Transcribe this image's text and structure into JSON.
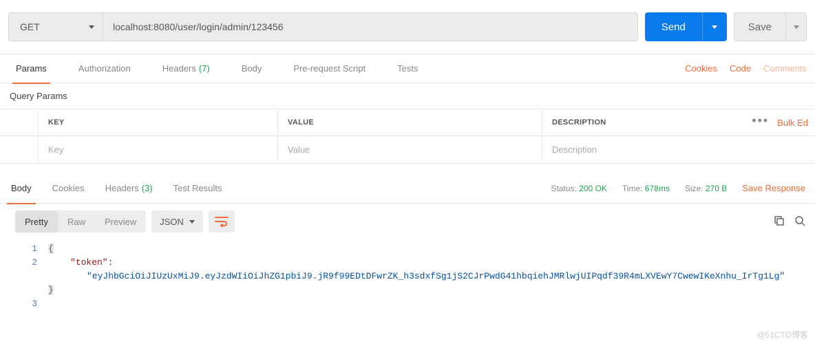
{
  "request": {
    "method": "GET",
    "url": "localhost:8080/user/login/admin/123456",
    "send_label": "Send",
    "save_label": "Save"
  },
  "req_tabs": {
    "params": "Params",
    "authorization": "Authorization",
    "headers": "Headers",
    "headers_count": "(7)",
    "body": "Body",
    "prerequest": "Pre-request Script",
    "tests": "Tests"
  },
  "req_links": {
    "cookies": "Cookies",
    "code": "Code",
    "comments": "Comments"
  },
  "query_params": {
    "title": "Query Params",
    "headers": {
      "key": "KEY",
      "value": "VALUE",
      "description": "DESCRIPTION"
    },
    "row_placeholders": {
      "key": "Key",
      "value": "Value",
      "description": "Description"
    },
    "bulk_edit": "Bulk Ed"
  },
  "resp_tabs": {
    "body": "Body",
    "cookies": "Cookies",
    "headers": "Headers",
    "headers_count": "(3)",
    "test_results": "Test Results"
  },
  "resp_meta": {
    "status_label": "Status:",
    "status_value": "200 OK",
    "time_label": "Time:",
    "time_value": "678ms",
    "size_label": "Size:",
    "size_value": "270 B",
    "save_response": "Save Response"
  },
  "view": {
    "pretty": "Pretty",
    "raw": "Raw",
    "preview": "Preview",
    "format": "JSON"
  },
  "response_body": {
    "key": "\"token\"",
    "value": "\"eyJhbGciOiJIUzUxMiJ9.eyJzdWIiOiJhZG1pbiJ9.jR9f99EDtDFwrZK_h3sdxfSg1jS2CJrPwdG41hbqiehJMRlwjUIPqdf39R4mLXVEwY7CwewIKeXnhu_IrTg1Lg\""
  },
  "line_numbers": [
    "1",
    "2",
    "3"
  ],
  "watermark": "@51CTO博客"
}
